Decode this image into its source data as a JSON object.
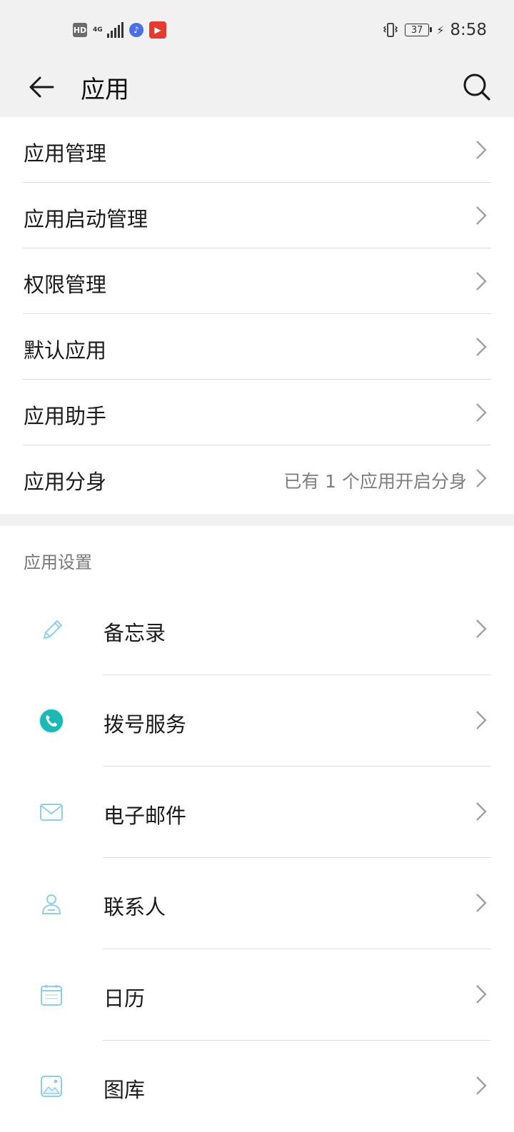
{
  "status_bar": {
    "hd_badge": "HD",
    "network_type": "4G",
    "battery_level": "37",
    "time": "8:58"
  },
  "app_bar": {
    "title": "应用",
    "back_icon": "arrow-left-icon",
    "search_icon": "search-icon"
  },
  "menu": {
    "items": [
      {
        "label": "应用管理",
        "value": ""
      },
      {
        "label": "应用启动管理",
        "value": ""
      },
      {
        "label": "权限管理",
        "value": ""
      },
      {
        "label": "默认应用",
        "value": ""
      },
      {
        "label": "应用助手",
        "value": ""
      },
      {
        "label": "应用分身",
        "value": "已有 1 个应用开启分身"
      }
    ]
  },
  "app_settings": {
    "header": "应用设置",
    "items": [
      {
        "label": "备忘录",
        "icon": "notepad-pencil-icon"
      },
      {
        "label": "拨号服务",
        "icon": "phone-icon"
      },
      {
        "label": "电子邮件",
        "icon": "email-icon"
      },
      {
        "label": "联系人",
        "icon": "contacts-icon"
      },
      {
        "label": "日历",
        "icon": "calendar-icon"
      },
      {
        "label": "图库",
        "icon": "gallery-icon"
      }
    ]
  },
  "colors": {
    "bar_background": "#f1f1f1",
    "divider": "#dcdcdc",
    "secondary_text": "#7d7d7d",
    "phone_teal": "#1db8b3"
  }
}
